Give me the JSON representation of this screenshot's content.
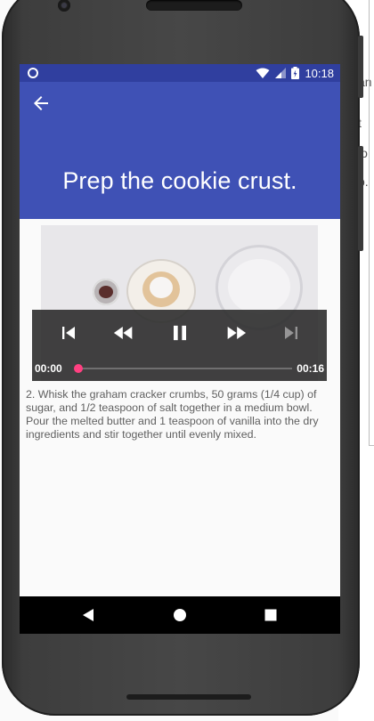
{
  "background": {
    "fragments": [
      "an",
      "t",
      "io",
      "o."
    ]
  },
  "status_bar": {
    "time": "10:18"
  },
  "app_bar": {
    "back_icon": "arrow-back-icon",
    "title": "Prep the cookie crust."
  },
  "player": {
    "current_time": "00:00",
    "duration": "00:16",
    "progress": 0,
    "buttons": [
      "skip-previous-icon",
      "rewind-icon",
      "pause-icon",
      "fast-forward-icon",
      "skip-next-icon"
    ]
  },
  "step": {
    "description": "2. Whisk the graham cracker crumbs, 50 grams (1/4 cup) of sugar, and 1/2 teaspoon of salt together in a medium bowl. Pour the melted butter and 1 teaspoon of vanilla into the dry ingredients and stir together until evenly mixed."
  },
  "navigation": {
    "icons": [
      "back-triangle-icon",
      "home-circle-icon",
      "recents-square-icon"
    ]
  },
  "colors": {
    "primary": "#3f51b5",
    "primary_dark": "#303f9f",
    "accent": "#ff4081"
  }
}
